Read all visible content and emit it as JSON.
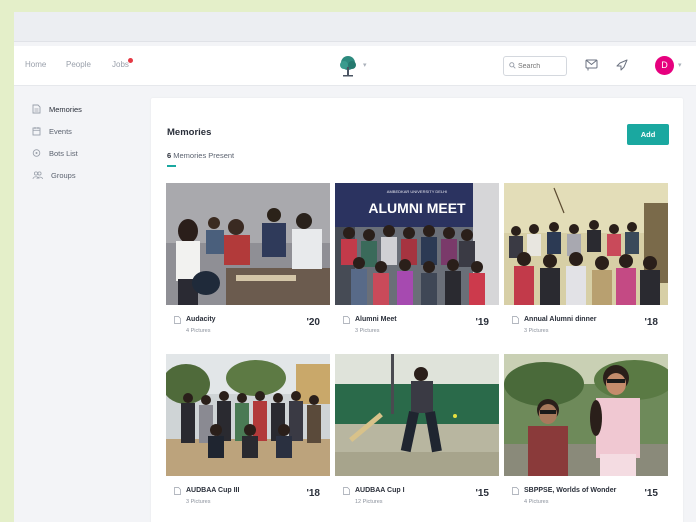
{
  "navbar": {
    "links": [
      "Home",
      "People",
      "Jobs"
    ],
    "search_placeholder": "Search",
    "avatar_initial": "D"
  },
  "sidebar": {
    "items": [
      {
        "label": "Memories",
        "icon": "memories-icon"
      },
      {
        "label": "Events",
        "icon": "events-icon"
      },
      {
        "label": "Bots List",
        "icon": "bots-list-icon"
      },
      {
        "label": "Groups",
        "icon": "groups-icon"
      }
    ]
  },
  "main": {
    "title": "Memories",
    "count": "6",
    "count_suffix": "Memories Present",
    "add_label": "Add",
    "cards": [
      {
        "title": "Audacity",
        "subtitle": "4 Pictures",
        "year": "'20"
      },
      {
        "title": "Alumni Meet",
        "subtitle": "3 Pictures",
        "year": "'19",
        "banner": "ALUMNI MEET",
        "banner_top": "AMBEDKAR UNIVERSITY DELHI"
      },
      {
        "title": "Annual Alumni dinner",
        "subtitle": "3 Pictures",
        "year": "'18"
      },
      {
        "title": "AUDBAA Cup III",
        "subtitle": "3 Pictures",
        "year": "'18"
      },
      {
        "title": "AUDBAA Cup I",
        "subtitle": "12 Pictures",
        "year": "'15"
      },
      {
        "title": "SBPPSE, Worlds of Wonder",
        "subtitle": "4 Pictures",
        "year": "'15"
      }
    ]
  },
  "colors": {
    "accent": "#1aa8a0",
    "avatar": "#e6007e",
    "notification": "#e53945",
    "outer_background": "#e4efc9"
  }
}
